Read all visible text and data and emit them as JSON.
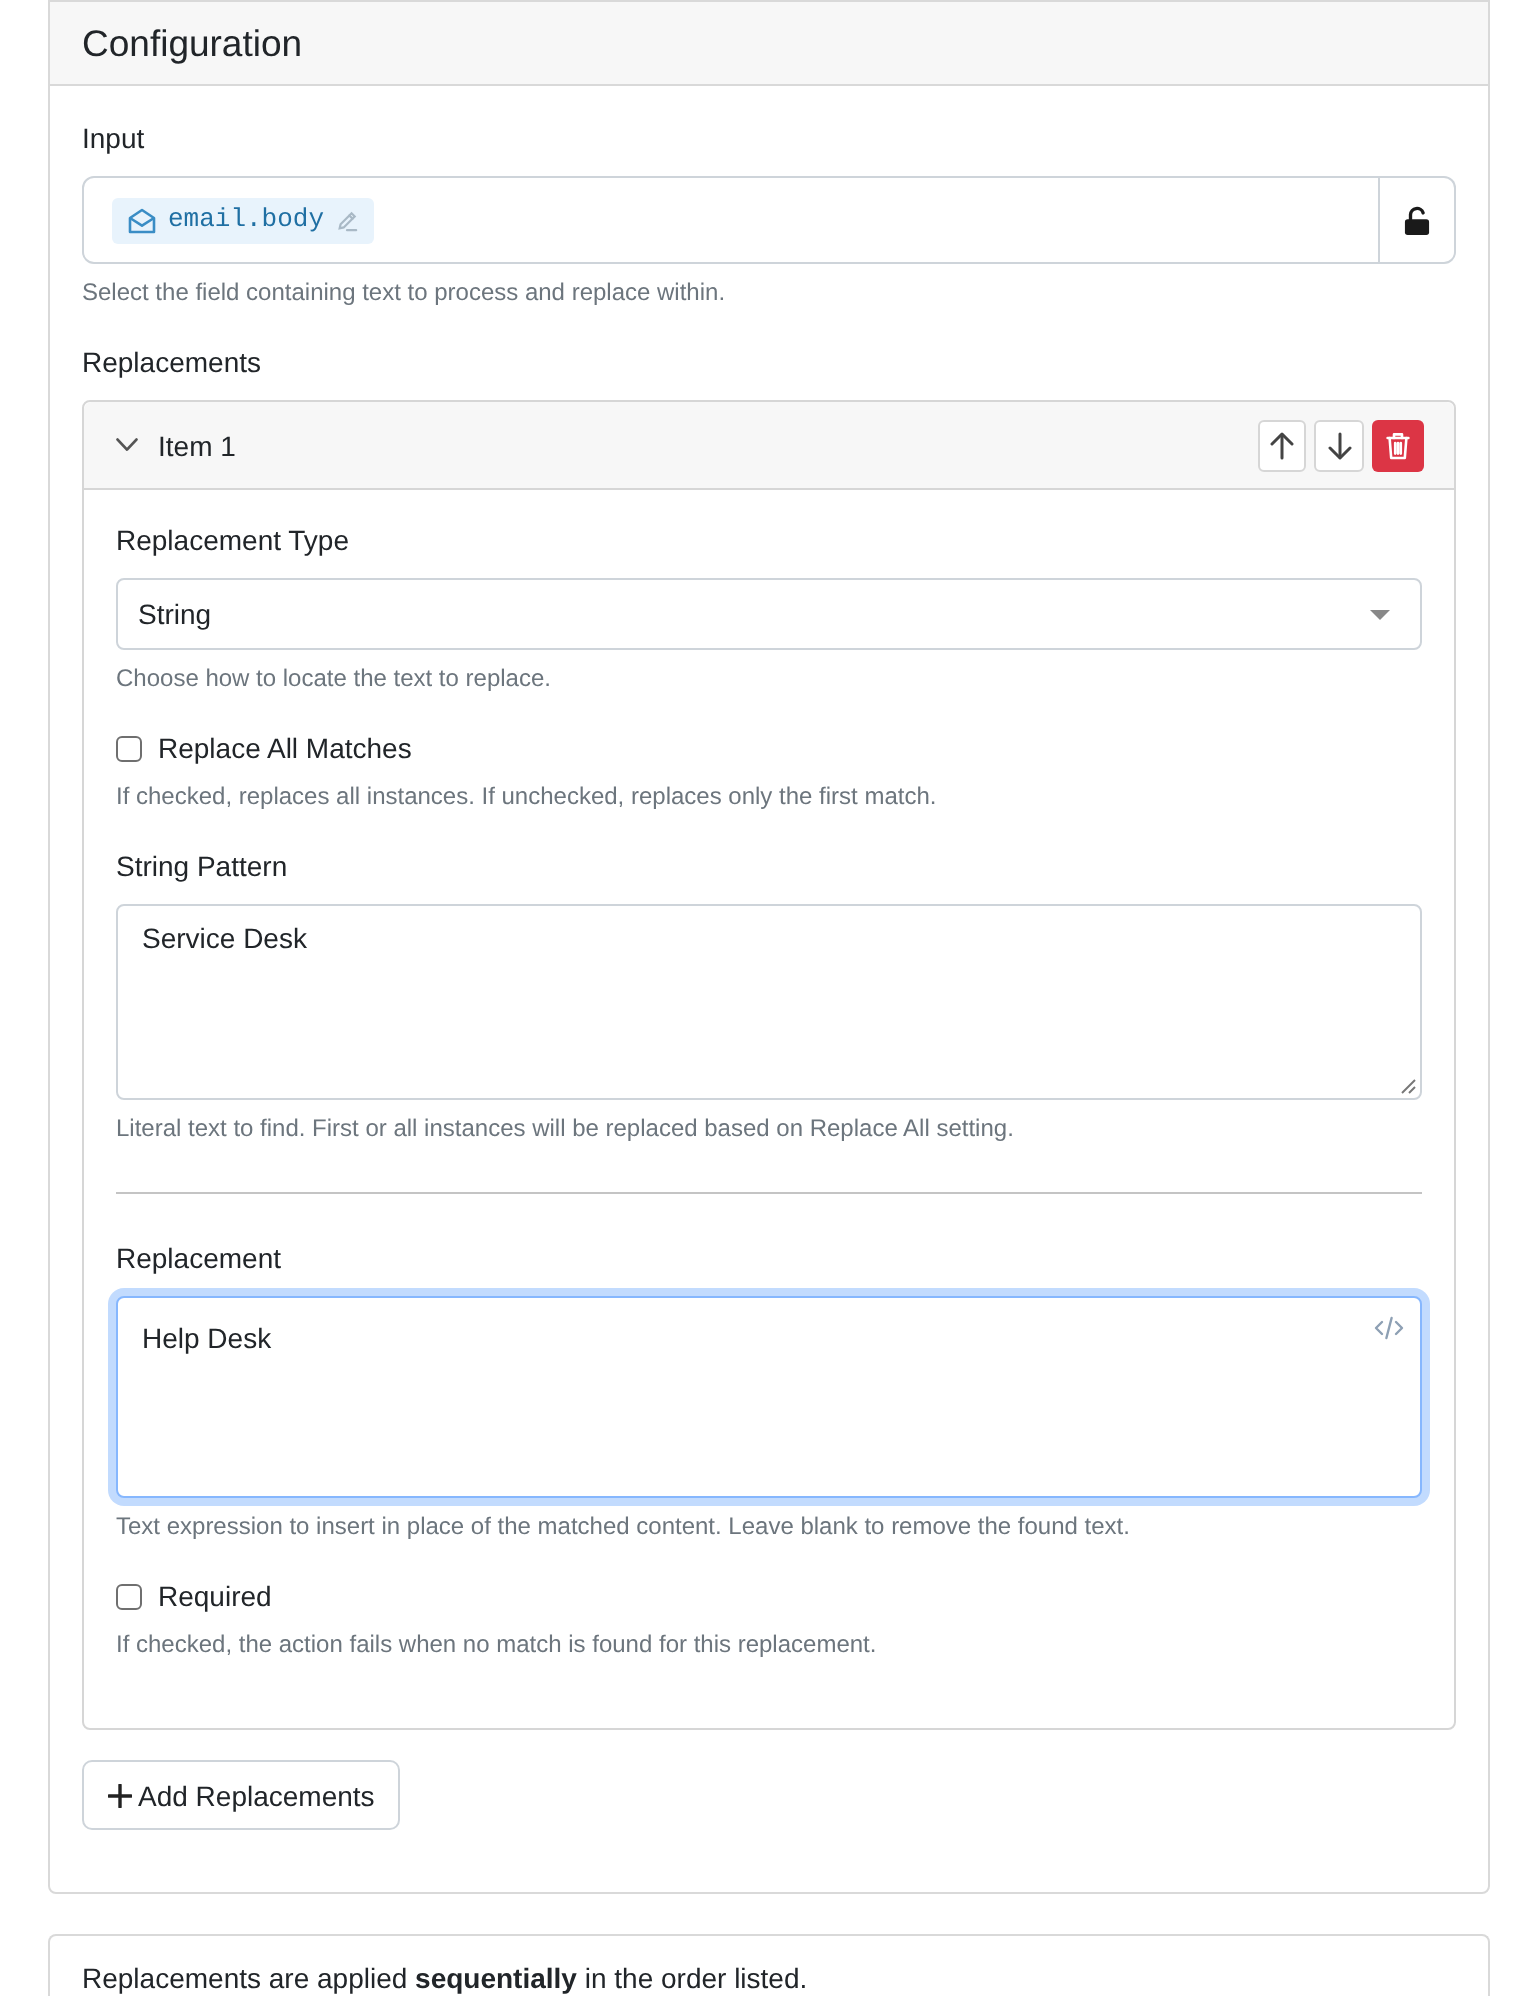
{
  "panel": {
    "title": "Configuration"
  },
  "input": {
    "label": "Input",
    "token": "email.body",
    "locked": false,
    "hint": "Select the field containing text to process and replace within."
  },
  "replacements": {
    "label": "Replacements",
    "items": [
      {
        "title": "Item 1",
        "expanded": true,
        "fields": [
          {
            "kind": "select",
            "label": "Replacement Type",
            "value": "String",
            "hint": "Choose how to locate the text to replace."
          },
          {
            "kind": "checkbox",
            "label": "Replace All Matches",
            "checked": false,
            "hint": "If checked, replaces all instances. If unchecked, replaces only the first match."
          },
          {
            "kind": "textarea",
            "label": "String Pattern",
            "value": "Service Desk",
            "focused": false,
            "hint": "Literal text to find. First or all instances will be replaced based on Replace All setting."
          },
          {
            "kind": "divider"
          },
          {
            "kind": "expression",
            "label": "Replacement",
            "value": "Help Desk",
            "focused": true,
            "hint": "Text expression to insert in place of the matched content. Leave blank to remove the found text."
          },
          {
            "kind": "checkbox",
            "label": "Required",
            "checked": false,
            "hint": "If checked, the action fails when no match is found for this replacement."
          }
        ]
      }
    ],
    "add_button": "Add Replacements"
  },
  "note": {
    "text": "Replacements are applied **sequentially** in the order listed."
  }
}
